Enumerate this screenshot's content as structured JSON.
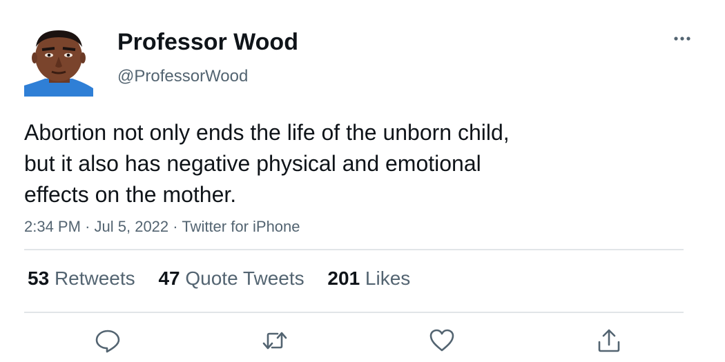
{
  "tweet": {
    "display_name": "Professor Wood",
    "handle": "@ProfessorWood",
    "text_lines": [
      "Abortion not only ends the life of the unborn child,",
      "but it also has negative physical and emotional",
      "effects on the mother."
    ],
    "time": "2:34 PM",
    "separator": "·",
    "date": "Jul 5, 2022",
    "source": "Twitter for iPhone"
  },
  "stats": {
    "retweets": {
      "count": "53",
      "label": "Retweets"
    },
    "quotes": {
      "count": "47",
      "label": "Quote Tweets"
    },
    "likes": {
      "count": "201",
      "label": "Likes"
    }
  },
  "icons": {
    "more": "more-horizontal-icon",
    "reply": "reply-icon",
    "retweet": "retweet-icon",
    "like": "heart-icon",
    "share": "share-icon"
  },
  "colors": {
    "primary_text": "#0f1419",
    "secondary_text": "#536471",
    "divider": "#e1e5e8"
  }
}
